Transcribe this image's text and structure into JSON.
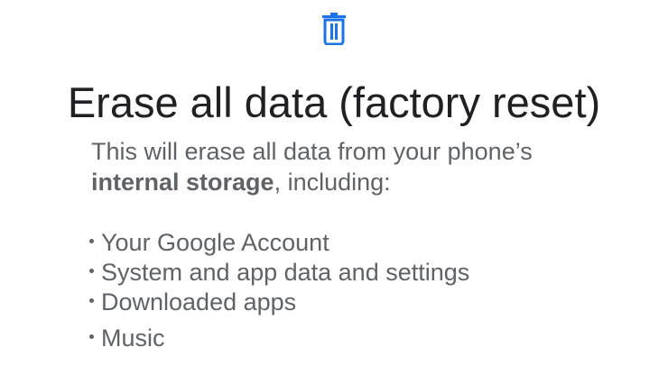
{
  "header": {
    "icon": "trash-icon",
    "icon_color": "#1a73e8"
  },
  "dialog": {
    "title": "Erase all data (factory reset)",
    "body_prefix": "This will erase all data from your phone’s",
    "body_bold": "internal storage",
    "body_suffix": ", including:",
    "items": [
      "Your Google Account",
      "System and app data and settings",
      "Downloaded apps",
      "Music"
    ]
  },
  "colors": {
    "title": "#202124",
    "body": "#5f6368"
  }
}
